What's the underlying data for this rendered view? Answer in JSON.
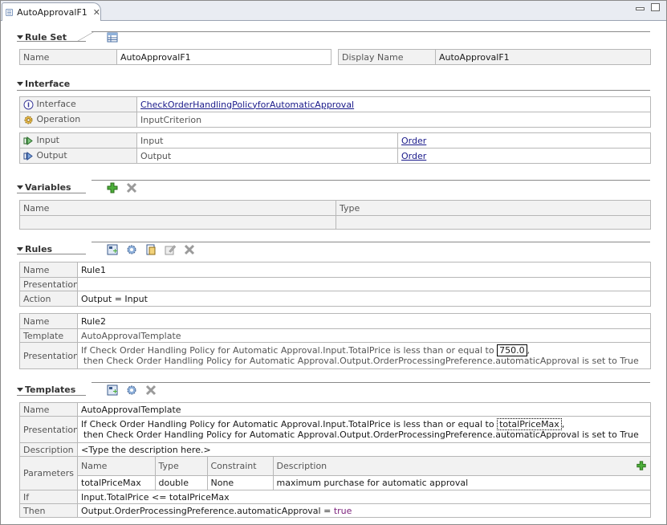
{
  "tab": {
    "title": "AutoApprovalF1"
  },
  "ruleSet": {
    "title": "Rule Set",
    "name_label": "Name",
    "name_value": "AutoApprovalF1",
    "display_label": "Display Name",
    "display_value": "AutoApprovalF1"
  },
  "interface": {
    "title": "Interface",
    "interface_label": "Interface",
    "interface_value": "CheckOrderHandlingPolicyforAutomaticApproval",
    "operation_label": "Operation",
    "operation_value": "InputCriterion",
    "input_label": "Input",
    "input_value": "Input",
    "input_type": "Order",
    "output_label": "Output",
    "output_value": "Output",
    "output_type": "Order"
  },
  "variables": {
    "title": "Variables",
    "col_name": "Name",
    "col_type": "Type"
  },
  "rules": {
    "title": "Rules",
    "rule1": {
      "name_label": "Name",
      "name_value": "Rule1",
      "presentation_label": "Presentation",
      "presentation_value": "",
      "action_label": "Action",
      "action_value": "Output = Input"
    },
    "rule2": {
      "name_label": "Name",
      "name_value": "Rule2",
      "template_label": "Template",
      "template_value": "AutoApprovalTemplate",
      "presentation_label": "Presentation",
      "presentation_line1_pre": "If Check Order Handling Policy for Automatic Approval.Input.TotalPrice is less than or equal to",
      "presentation_value": "750.0",
      "presentation_line1_post": ",",
      "presentation_line2": "then Check Order Handling Policy for Automatic Approval.Output.OrderProcessingPreference.automaticApproval is set to True"
    }
  },
  "templates": {
    "title": "Templates",
    "name_label": "Name",
    "name_value": "AutoApprovalTemplate",
    "presentation_label": "Presentation",
    "presentation_line1_pre": "If Check Order Handling Policy for Automatic Approval.Input.TotalPrice is less than or equal to",
    "presentation_param": "totalPriceMax",
    "presentation_line1_post": ",",
    "presentation_line2": "then Check Order Handling Policy for Automatic Approval.Output.OrderProcessingPreference.automaticApproval is set to True",
    "description_label": "Description",
    "description_value": "<Type the description here.>",
    "parameters_label": "Parameters",
    "param_cols": {
      "name": "Name",
      "type": "Type",
      "constraint": "Constraint",
      "description": "Description"
    },
    "param_row": {
      "name": "totalPriceMax",
      "type": "double",
      "constraint": "None",
      "description": "maximum purchase for automatic approval"
    },
    "if_label": "If",
    "if_value": "Input.TotalPrice <= totalPriceMax",
    "then_label": "Then",
    "then_pre": "Output.OrderProcessingPreference.automaticApproval = ",
    "then_kw": "true"
  }
}
